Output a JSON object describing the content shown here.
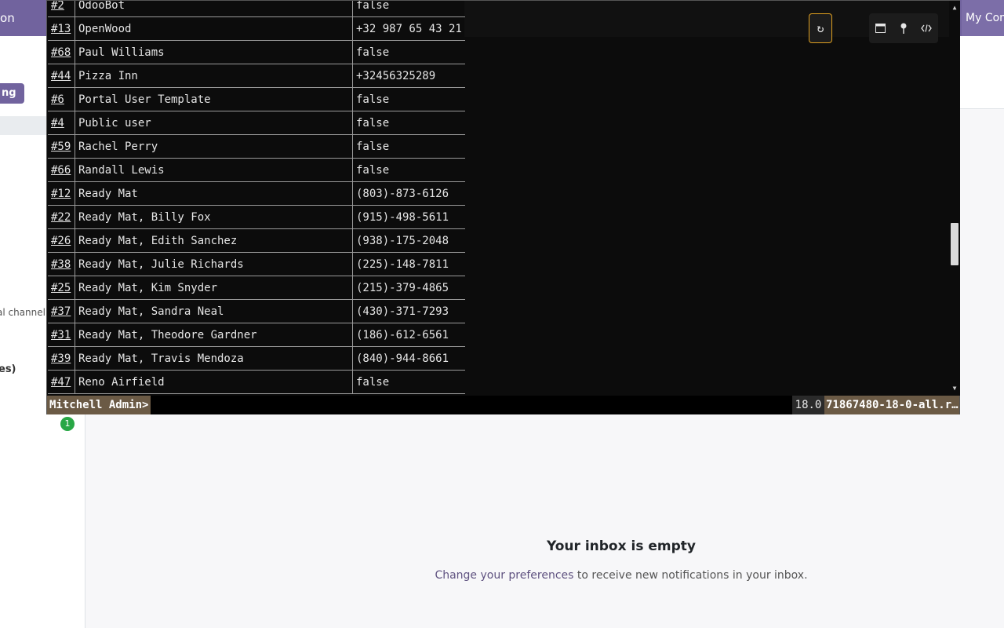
{
  "app": {
    "name": "tion",
    "company": "My Com",
    "action_button": "ng"
  },
  "sidebar": {
    "channel_fragment": "al channel",
    "section_fragment": "es)",
    "badge": "1"
  },
  "inbox": {
    "empty_title": "Your inbox is empty",
    "preferences_link": "Change your preferences",
    "empty_text": " to receive new notifications in your inbox."
  },
  "terminal": {
    "rows": [
      {
        "id": "#2",
        "name": "OdooBot",
        "value": "false"
      },
      {
        "id": "#13",
        "name": "OpenWood",
        "value": "+32 987 65 43 21"
      },
      {
        "id": "#68",
        "name": "Paul Williams",
        "value": "false"
      },
      {
        "id": "#44",
        "name": "Pizza Inn",
        "value": "+32456325289"
      },
      {
        "id": "#6",
        "name": "Portal User Template",
        "value": "false"
      },
      {
        "id": "#4",
        "name": "Public user",
        "value": "false"
      },
      {
        "id": "#59",
        "name": "Rachel Perry",
        "value": "false"
      },
      {
        "id": "#66",
        "name": "Randall Lewis",
        "value": "false"
      },
      {
        "id": "#12",
        "name": "Ready Mat",
        "value": "(803)-873-6126"
      },
      {
        "id": "#22",
        "name": "Ready Mat, Billy Fox",
        "value": "(915)-498-5611"
      },
      {
        "id": "#26",
        "name": "Ready Mat, Edith Sanchez",
        "value": "(938)-175-2048"
      },
      {
        "id": "#38",
        "name": "Ready Mat, Julie Richards",
        "value": "(225)-148-7811"
      },
      {
        "id": "#25",
        "name": "Ready Mat, Kim Snyder",
        "value": "(215)-379-4865"
      },
      {
        "id": "#37",
        "name": "Ready Mat, Sandra Neal",
        "value": "(430)-371-7293"
      },
      {
        "id": "#31",
        "name": "Ready Mat, Theodore Gardner",
        "value": "(186)-612-6561"
      },
      {
        "id": "#39",
        "name": "Ready Mat, Travis Mendoza",
        "value": "(840)-944-8661"
      },
      {
        "id": "#47",
        "name": "Reno Airfield",
        "value": "false"
      }
    ],
    "icons": {
      "refresh": "refresh-icon",
      "maximize": "window-maximize-icon",
      "pin": "pin-icon",
      "code": "code-icon"
    },
    "scroll_position": 0.64,
    "prompt": "Mitchell Admin>",
    "version": "18.0",
    "database": "71867480-18-0-all.r…"
  }
}
